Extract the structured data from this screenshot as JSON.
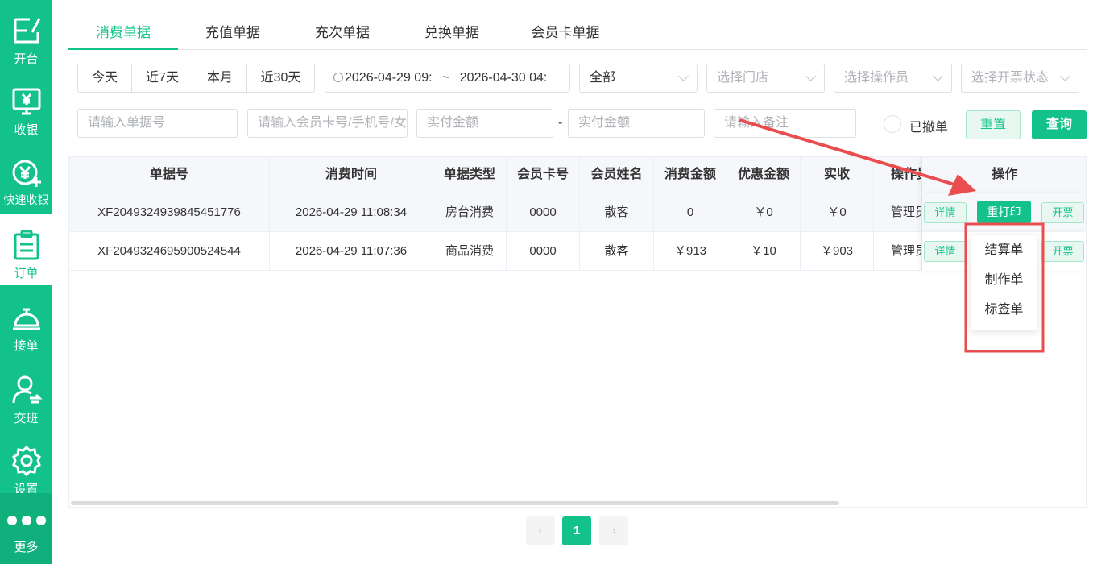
{
  "sidebar": {
    "items": [
      {
        "label": "开台"
      },
      {
        "label": "收银"
      },
      {
        "label": "快速收银"
      },
      {
        "label": "订单"
      },
      {
        "label": "接单"
      },
      {
        "label": "交班"
      },
      {
        "label": "设置"
      },
      {
        "label": "更多"
      }
    ]
  },
  "tabs": [
    "消费单据",
    "充值单据",
    "充次单据",
    "兑换单据",
    "会员卡单据"
  ],
  "filters": {
    "quick_ranges": [
      "今天",
      "近7天",
      "本月",
      "近30天"
    ],
    "date_start": "2026-04-29 09:",
    "date_sep": "~",
    "date_end": "2026-04-30 04:",
    "type_value": "全部",
    "store_placeholder": "选择门店",
    "operator_placeholder": "选择操作员",
    "invoice_placeholder": "选择开票状态",
    "order_no_placeholder": "请输入单据号",
    "member_placeholder": "请输入会员卡号/手机号/女",
    "amount_min_placeholder": "实付金额",
    "amount_sep": "-",
    "amount_max_placeholder": "实付金额",
    "remark_placeholder": "请输入备注",
    "revoked_label": "已撤单",
    "reset_label": "重置",
    "query_label": "查询"
  },
  "table": {
    "headers": [
      "单据号",
      "消费时间",
      "单据类型",
      "会员卡号",
      "会员姓名",
      "消费金额",
      "优惠金额",
      "实收",
      "操作员",
      "操作"
    ],
    "rows": [
      [
        "XF2049324939845451776",
        "2026-04-29 11:08:34",
        "房台消费",
        "0000",
        "散客",
        "0",
        "￥0",
        "￥0",
        "管理员"
      ],
      [
        "XF2049324695900524544",
        "2026-04-29 11:07:36",
        "商品消费",
        "0000",
        "散客",
        "￥913",
        "￥10",
        "￥903",
        "管理员"
      ]
    ],
    "action_detail": "详情",
    "action_reprint": "重打印",
    "action_invoice": "开票"
  },
  "reprint_menu": [
    "结算单",
    "制作单",
    "标签单"
  ],
  "pagination": {
    "current": "1"
  },
  "colors": {
    "brand": "#13c28a",
    "annotation": "#ea4d4d"
  }
}
